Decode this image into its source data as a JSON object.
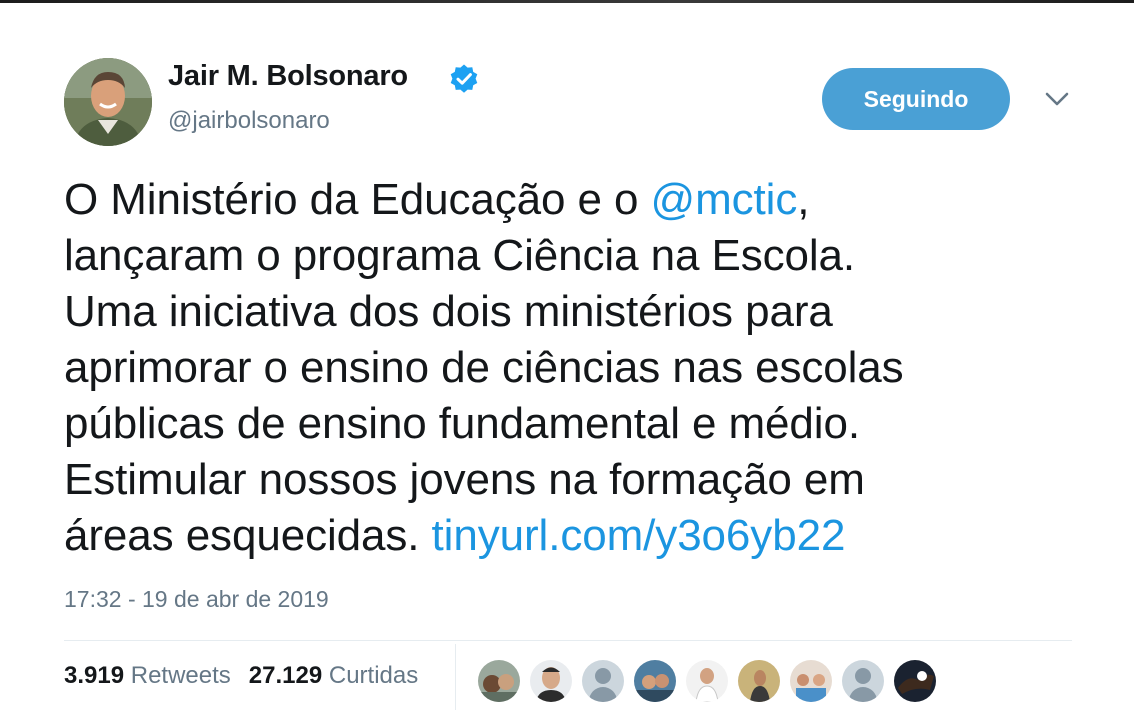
{
  "author": {
    "name": "Jair M. Bolsonaro",
    "handle": "@jairbolsonaro",
    "verified_icon": "verified-badge-icon",
    "avatar_icon": "avatar-photo"
  },
  "follow_button": {
    "label": "Seguindo"
  },
  "menu_icon": "chevron-down-icon",
  "tweet": {
    "lines": [
      {
        "text": "O Ministério da Educação e o ",
        "link": "@mctic",
        "after": ","
      },
      {
        "text": "lançaram o programa Ciência na Escola."
      },
      {
        "text": "Uma iniciativa dos dois ministérios para"
      },
      {
        "text": "aprimorar o ensino de ciências nas escolas"
      },
      {
        "text": "públicas de ensino fundamental e médio."
      },
      {
        "text": "Estimular nossos jovens na formação em"
      },
      {
        "text": "áreas esquecidas. ",
        "link": "tinyurl.com/y3o6yb22"
      }
    ],
    "timestamp": "17:32 - 19 de abr de 2019"
  },
  "stats": {
    "retweets_count": "3.919",
    "retweets_label": "Retweets",
    "likes_count": "27.129",
    "likes_label": "Curtidas"
  },
  "colors": {
    "link": "#1b95e0",
    "follow_button": "#4aa0d5",
    "secondary_text": "#657786",
    "verified": "#1da1f2"
  }
}
